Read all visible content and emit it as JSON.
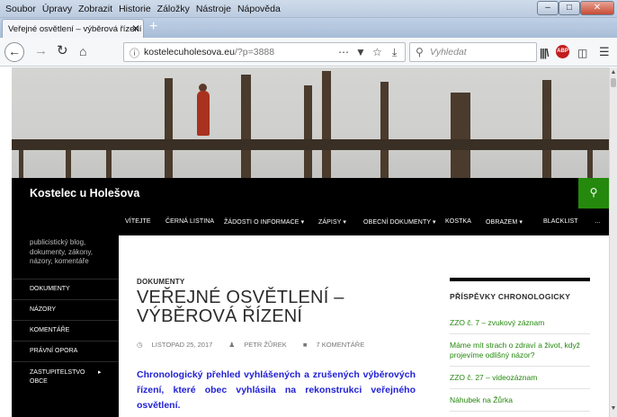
{
  "browser": {
    "menu": [
      "Soubor",
      "Úpravy",
      "Zobrazit",
      "Historie",
      "Záložky",
      "Nástroje",
      "Nápověda"
    ],
    "tab_title": "Veřejné osvětlení – výběrová řízení",
    "tab_close": "✕",
    "new_tab": "+",
    "url_host": "kostelecuholesova.eu",
    "url_path": "/?p=3888",
    "search_placeholder": "Vyhledat",
    "ctrl_min": "–",
    "ctrl_max": "□",
    "ctrl_close": "✕",
    "abp_label": "ABP"
  },
  "site": {
    "title": "Kostelec u Holešova",
    "tagline": "publicistický blog, dokumenty, zákony, názory, komentáře",
    "nav": [
      {
        "label": "VÍTEJTE"
      },
      {
        "label": "ČERNÁ LISTINA"
      },
      {
        "label": "ŽÁDOSTI O INFORMACE ▾"
      },
      {
        "label": "ZÁPISY ▾"
      },
      {
        "label": "OBECNÍ DOKUMENTY ▾"
      },
      {
        "label": "KOSTKA"
      },
      {
        "label": "OBRAZEM ▾"
      },
      {
        "label": "BLACKLIST"
      },
      {
        "label": "…"
      }
    ],
    "sidebar_menu": [
      {
        "label": "DOKUMENTY"
      },
      {
        "label": "NÁZORY"
      },
      {
        "label": "KOMENTÁŘE"
      },
      {
        "label": "PRÁVNÍ OPORA"
      },
      {
        "label": "ZASTUPITELSTVO OBCE"
      }
    ]
  },
  "post": {
    "category": "DOKUMENTY",
    "title": "VEŘEJNÉ OSVĚTLENÍ – VÝBĚROVÁ ŘÍZENÍ",
    "date": "LISTOPAD 25, 2017",
    "author": "PETR ŽŮREK",
    "comments": "7 KOMENTÁŘE",
    "excerpt": "Chronologický přehled vyhlášených a zrušených výběrových řízení, které obec vyhlásila na rekonstrukci veřejného osvětlení."
  },
  "widget": {
    "title": "PŘÍSPĚVKY CHRONOLOGICKY",
    "links": [
      {
        "label": "ZZO č. 7 – zvukový záznam"
      },
      {
        "label": "Máme mít strach o zdraví a život, když projevíme odlišný názor?"
      },
      {
        "label": "ZZO č. 27 – videozáznam"
      },
      {
        "label": "Náhubek na Žůrka"
      }
    ]
  }
}
